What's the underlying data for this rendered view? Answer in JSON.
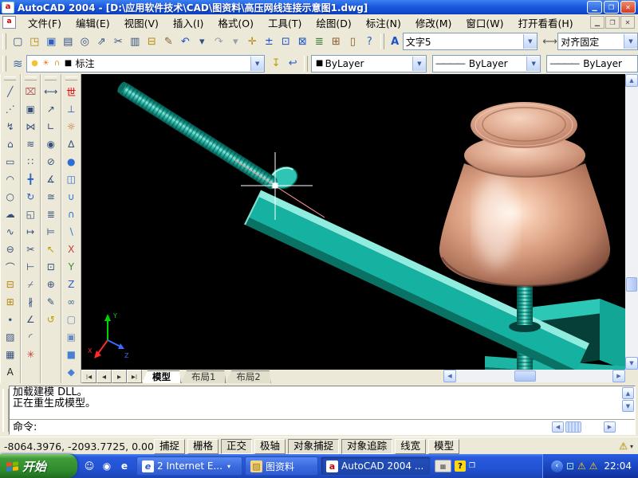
{
  "window": {
    "title": "AutoCAD 2004 - [D:\\应用软件技术\\CAD\\图资料\\高压网线连接示意图1.dwg]",
    "app_icon_glyph": "a",
    "controls": {
      "minimize": "▁",
      "restore": "❐",
      "close": "✕"
    }
  },
  "menu": {
    "items": [
      {
        "name": "menu-file",
        "label": "文件(F)"
      },
      {
        "name": "menu-edit",
        "label": "编辑(E)"
      },
      {
        "name": "menu-view",
        "label": "视图(V)"
      },
      {
        "name": "menu-insert",
        "label": "插入(I)"
      },
      {
        "name": "menu-format",
        "label": "格式(O)"
      },
      {
        "name": "menu-tools",
        "label": "工具(T)"
      },
      {
        "name": "menu-draw",
        "label": "绘图(D)"
      },
      {
        "name": "menu-dimension",
        "label": "标注(N)"
      },
      {
        "name": "menu-modify",
        "label": "修改(M)"
      },
      {
        "name": "menu-window",
        "label": "窗口(W)"
      },
      {
        "name": "menu-help",
        "label": "打开看看(H)"
      }
    ]
  },
  "toolbar_standard": {
    "icons": [
      {
        "name": "new-icon",
        "glyph": "▢"
      },
      {
        "name": "open-icon",
        "glyph": "◳",
        "color": "#b8860b"
      },
      {
        "name": "save-icon",
        "glyph": "▣",
        "color": "#2b5fc0"
      },
      {
        "name": "plot-icon",
        "glyph": "▤"
      },
      {
        "name": "plot-preview-icon",
        "glyph": "◎"
      },
      {
        "name": "publish-icon",
        "glyph": "⇗"
      },
      {
        "name": "cut-icon",
        "glyph": "✂"
      },
      {
        "name": "copy-icon",
        "glyph": "▥"
      },
      {
        "name": "paste-icon",
        "glyph": "⊟",
        "color": "#b8860b"
      },
      {
        "name": "match-properties-icon",
        "glyph": "✎",
        "color": "#8a5a2a"
      },
      {
        "name": "undo-icon",
        "glyph": "↶",
        "color": "#1a50c8"
      },
      {
        "name": "undo-caret-icon",
        "glyph": "▾"
      },
      {
        "name": "redo-icon",
        "glyph": "↷",
        "color": "#9aa0a8"
      },
      {
        "name": "redo-caret-icon",
        "glyph": "▾",
        "color": "#9aa0a8"
      },
      {
        "name": "pan-icon",
        "glyph": "✛",
        "color": "#b8860b"
      },
      {
        "name": "zoom-realtime-icon",
        "glyph": "±",
        "color": "#1a50c8"
      },
      {
        "name": "zoom-window-icon",
        "glyph": "⊡",
        "color": "#1a50c8"
      },
      {
        "name": "zoom-previous-icon",
        "glyph": "⊠",
        "color": "#1a50c8"
      },
      {
        "name": "properties-icon",
        "glyph": "≣",
        "color": "#3a7a3a"
      },
      {
        "name": "designcenter-icon",
        "glyph": "⊞",
        "color": "#8a5a2a"
      },
      {
        "name": "tool-palettes-icon",
        "glyph": "▯",
        "color": "#8a5a2a"
      },
      {
        "name": "help-icon",
        "glyph": "?",
        "color": "#2b5fc0"
      }
    ]
  },
  "toolbar_styles": {
    "text_style_icon": {
      "name": "text-style-icon",
      "glyph": "A",
      "color": "#1a50c8"
    },
    "text_style_value": "文字5",
    "dim_style_icon": {
      "name": "dim-style-icon",
      "glyph": "⟷",
      "color": "#555555"
    },
    "dim_style_value": "对齐固定"
  },
  "toolbar_layers": {
    "layers_icon": {
      "glyph": "≋",
      "color": "#3a6aa0"
    },
    "state_icons": [
      {
        "name": "layer-on-bulb-icon",
        "glyph": "●",
        "color": "#f4c430"
      },
      {
        "name": "layer-freeze-sun-icon",
        "glyph": "☀",
        "color": "#f08020"
      },
      {
        "name": "layer-lock-icon",
        "glyph": "∩",
        "color": "#c8a030"
      },
      {
        "name": "layer-color-swatch",
        "glyph": "■",
        "color": "#000000"
      }
    ],
    "current_layer": "标注",
    "buttons": [
      {
        "name": "make-object-layer-current-icon",
        "glyph": "↧",
        "color": "#b8a000"
      },
      {
        "name": "layer-previous-icon",
        "glyph": "↩",
        "color": "#2b5fc0"
      }
    ]
  },
  "toolbar_properties": {
    "color_value": "ByLayer",
    "linetype_sample": "————",
    "linetype_value": "ByLayer",
    "lineweight_sample": "————",
    "lineweight_value": "ByLayer"
  },
  "left_toolbars": {
    "draw": [
      {
        "name": "line-icon",
        "glyph": "╱"
      },
      {
        "name": "construction-line-icon",
        "glyph": "⋰"
      },
      {
        "name": "polyline-icon",
        "glyph": "↯"
      },
      {
        "name": "polygon-icon",
        "glyph": "⌂"
      },
      {
        "name": "rectangle-icon",
        "glyph": "▭"
      },
      {
        "name": "arc-icon",
        "glyph": "◠"
      },
      {
        "name": "circle-icon",
        "glyph": "○"
      },
      {
        "name": "revision-cloud-icon",
        "glyph": "☁"
      },
      {
        "name": "spline-icon",
        "glyph": "∿"
      },
      {
        "name": "ellipse-icon",
        "glyph": "⊖"
      },
      {
        "name": "ellipse-arc-icon",
        "glyph": "⌒"
      },
      {
        "name": "insert-block-icon",
        "glyph": "⊟",
        "color": "#b8860b"
      },
      {
        "name": "make-block-icon",
        "glyph": "⊞",
        "color": "#b8860b"
      },
      {
        "name": "point-icon",
        "glyph": "∙"
      },
      {
        "name": "hatch-icon",
        "glyph": "▨"
      },
      {
        "name": "region-icon",
        "glyph": "▦"
      },
      {
        "name": "text-icon",
        "glyph": "A",
        "color": "#222222"
      }
    ],
    "modify": [
      {
        "name": "erase-icon",
        "glyph": "⌧",
        "color": "#b06060"
      },
      {
        "name": "copy-object-icon",
        "glyph": "▣"
      },
      {
        "name": "mirror-icon",
        "glyph": "⋈"
      },
      {
        "name": "offset-icon",
        "glyph": "≋"
      },
      {
        "name": "array-icon",
        "glyph": "∷"
      },
      {
        "name": "move-icon",
        "glyph": "╋",
        "color": "#2b5fc0"
      },
      {
        "name": "rotate-icon",
        "glyph": "↻",
        "color": "#2b5fc0"
      },
      {
        "name": "scale-icon",
        "glyph": "◱"
      },
      {
        "name": "stretch-icon",
        "glyph": "↦"
      },
      {
        "name": "trim-icon",
        "glyph": "✂"
      },
      {
        "name": "extend-icon",
        "glyph": "⊢"
      },
      {
        "name": "break-at-point-icon",
        "glyph": "⌿"
      },
      {
        "name": "break-icon",
        "glyph": "∦"
      },
      {
        "name": "chamfer-icon",
        "glyph": "∠"
      },
      {
        "name": "fillet-icon",
        "glyph": "◜"
      },
      {
        "name": "explode-icon",
        "glyph": "✳",
        "color": "#c04040"
      }
    ],
    "dimension": [
      {
        "name": "linear-dimension-icon",
        "glyph": "⟷"
      },
      {
        "name": "aligned-dimension-icon",
        "glyph": "↗"
      },
      {
        "name": "ordinate-dimension-icon",
        "glyph": "∟"
      },
      {
        "name": "radius-dimension-icon",
        "glyph": "◉"
      },
      {
        "name": "diameter-dimension-icon",
        "glyph": "⊘"
      },
      {
        "name": "angular-dimension-icon",
        "glyph": "∡"
      },
      {
        "name": "quick-dimension-icon",
        "glyph": "≅"
      },
      {
        "name": "baseline-dimension-icon",
        "glyph": "≣"
      },
      {
        "name": "continue-dimension-icon",
        "glyph": "⊨"
      },
      {
        "name": "quick-leader-icon",
        "glyph": "↖",
        "color": "#b8a000"
      },
      {
        "name": "tolerance-icon",
        "glyph": "⊡"
      },
      {
        "name": "center-mark-icon",
        "glyph": "⊕"
      },
      {
        "name": "dimension-edit-icon",
        "glyph": "✎"
      },
      {
        "name": "dimension-update-icon",
        "glyph": "↺",
        "color": "#b8a000"
      }
    ],
    "solids": [
      {
        "name": "world-text-icon",
        "glyph": "世",
        "color": "#e00000"
      },
      {
        "name": "ucs-toolbar-icon",
        "glyph": "⊥",
        "color": "#2255cc"
      },
      {
        "name": "render-icon",
        "glyph": "☼",
        "color": "#c06020"
      },
      {
        "name": "named-views-icon",
        "glyph": "∆"
      },
      {
        "name": "sphere-icon",
        "glyph": "●",
        "color": "#2b6fd4"
      },
      {
        "name": "extrude-icon",
        "glyph": "◫",
        "color": "#2b6fd4"
      },
      {
        "name": "union-icon",
        "glyph": "∪",
        "color": "#2b6fd4"
      },
      {
        "name": "intersect-icon",
        "glyph": "∩",
        "color": "#2b6fd4"
      },
      {
        "name": "subtract-icon",
        "glyph": "∖",
        "color": "#2b6fd4"
      },
      {
        "name": "rotate-x-ucs-icon",
        "glyph": "X",
        "color": "#c04040"
      },
      {
        "name": "rotate-y-ucs-icon",
        "glyph": "Y",
        "color": "#3a8a3a"
      },
      {
        "name": "rotate-z-ucs-icon",
        "glyph": "Z",
        "color": "#2b5fc0"
      },
      {
        "name": "3d-orbit-icon",
        "glyph": "∞",
        "color": "#3a6aa0"
      },
      {
        "name": "wireframe-box-icon",
        "glyph": "▢",
        "color": "#6a8ac0"
      },
      {
        "name": "hidden-box-icon",
        "glyph": "▣",
        "color": "#6a8ac0"
      },
      {
        "name": "shaded-box-icon",
        "glyph": "■",
        "color": "#4a7fd6"
      },
      {
        "name": "cone-icon",
        "glyph": "◆",
        "color": "#4a7fd6"
      }
    ]
  },
  "drawing": {
    "background": "#000000",
    "model_colors": {
      "teal": "#14b0a0",
      "teal_light": "#90ecdf",
      "teal_dark": "#0a7264",
      "copper": "#d99d80",
      "copper_highlight": "#ffefe2",
      "copper_dark": "#6f4234"
    },
    "ucs": {
      "x_label": "X",
      "y_label": "Y",
      "z_label": "Z",
      "x_color": "#ff2a2a",
      "y_color": "#00d400",
      "z_color": "#3a6aff"
    }
  },
  "tabs": {
    "nav": [
      {
        "name": "first-tab-icon",
        "glyph": "|◀"
      },
      {
        "name": "prev-tab-icon",
        "glyph": "◀"
      },
      {
        "name": "next-tab-icon",
        "glyph": "▶"
      },
      {
        "name": "last-tab-icon",
        "glyph": "▶|"
      }
    ],
    "items": [
      {
        "label": "模型",
        "active": true
      },
      {
        "label": "布局1"
      },
      {
        "label": "布局2"
      }
    ]
  },
  "glyphs": {
    "up": "▲",
    "down": "▼",
    "left": "◀",
    "right": "▶",
    "caret": "▾"
  },
  "command": {
    "history_line1": "加载建模 DLL。",
    "history_line2": "正在重生成模型。",
    "prompt": "命令:"
  },
  "status": {
    "coordinates": "-8064.3976, -2093.7725,  0.0000",
    "toggles": [
      {
        "name": "toggle-snap",
        "label": "捕捉"
      },
      {
        "name": "toggle-grid",
        "label": "栅格"
      },
      {
        "name": "toggle-ortho",
        "label": "正交",
        "pressed": true
      },
      {
        "name": "toggle-polar",
        "label": "极轴"
      },
      {
        "name": "toggle-osnap",
        "label": "对象捕捉",
        "pressed": true
      },
      {
        "name": "toggle-otrack",
        "label": "对象追踪",
        "pressed": true
      },
      {
        "name": "toggle-lineweight",
        "label": "线宽"
      },
      {
        "name": "toggle-model",
        "label": "模型"
      }
    ]
  },
  "taskbar": {
    "start_label": "开始",
    "tasks": [
      {
        "label": "2 Internet E...",
        "icon_glyph": "e"
      },
      {
        "label": "图资料",
        "icon_glyph": "▨"
      },
      {
        "label": "AutoCAD 2004 ...",
        "icon_glyph": "a",
        "active": true
      }
    ],
    "quick_launch": [
      {
        "name": "quick-launch-app-icon",
        "glyph": "☺",
        "cls": "q1"
      },
      {
        "name": "media-player-icon",
        "glyph": "◉",
        "cls": "q2"
      },
      {
        "name": "internet-explorer-icon",
        "glyph": "e",
        "cls": "q3"
      }
    ],
    "clock": "22:04"
  }
}
